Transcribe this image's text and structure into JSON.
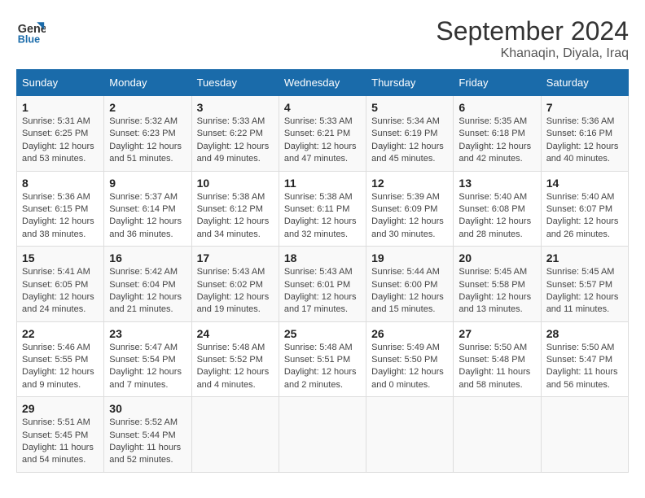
{
  "header": {
    "logo_line1": "General",
    "logo_line2": "Blue",
    "month": "September 2024",
    "location": "Khanaqin, Diyala, Iraq"
  },
  "days_of_week": [
    "Sunday",
    "Monday",
    "Tuesday",
    "Wednesday",
    "Thursday",
    "Friday",
    "Saturday"
  ],
  "weeks": [
    [
      {
        "day": "1",
        "sunrise": "Sunrise: 5:31 AM",
        "sunset": "Sunset: 6:25 PM",
        "daylight": "Daylight: 12 hours and 53 minutes."
      },
      {
        "day": "2",
        "sunrise": "Sunrise: 5:32 AM",
        "sunset": "Sunset: 6:23 PM",
        "daylight": "Daylight: 12 hours and 51 minutes."
      },
      {
        "day": "3",
        "sunrise": "Sunrise: 5:33 AM",
        "sunset": "Sunset: 6:22 PM",
        "daylight": "Daylight: 12 hours and 49 minutes."
      },
      {
        "day": "4",
        "sunrise": "Sunrise: 5:33 AM",
        "sunset": "Sunset: 6:21 PM",
        "daylight": "Daylight: 12 hours and 47 minutes."
      },
      {
        "day": "5",
        "sunrise": "Sunrise: 5:34 AM",
        "sunset": "Sunset: 6:19 PM",
        "daylight": "Daylight: 12 hours and 45 minutes."
      },
      {
        "day": "6",
        "sunrise": "Sunrise: 5:35 AM",
        "sunset": "Sunset: 6:18 PM",
        "daylight": "Daylight: 12 hours and 42 minutes."
      },
      {
        "day": "7",
        "sunrise": "Sunrise: 5:36 AM",
        "sunset": "Sunset: 6:16 PM",
        "daylight": "Daylight: 12 hours and 40 minutes."
      }
    ],
    [
      {
        "day": "8",
        "sunrise": "Sunrise: 5:36 AM",
        "sunset": "Sunset: 6:15 PM",
        "daylight": "Daylight: 12 hours and 38 minutes."
      },
      {
        "day": "9",
        "sunrise": "Sunrise: 5:37 AM",
        "sunset": "Sunset: 6:14 PM",
        "daylight": "Daylight: 12 hours and 36 minutes."
      },
      {
        "day": "10",
        "sunrise": "Sunrise: 5:38 AM",
        "sunset": "Sunset: 6:12 PM",
        "daylight": "Daylight: 12 hours and 34 minutes."
      },
      {
        "day": "11",
        "sunrise": "Sunrise: 5:38 AM",
        "sunset": "Sunset: 6:11 PM",
        "daylight": "Daylight: 12 hours and 32 minutes."
      },
      {
        "day": "12",
        "sunrise": "Sunrise: 5:39 AM",
        "sunset": "Sunset: 6:09 PM",
        "daylight": "Daylight: 12 hours and 30 minutes."
      },
      {
        "day": "13",
        "sunrise": "Sunrise: 5:40 AM",
        "sunset": "Sunset: 6:08 PM",
        "daylight": "Daylight: 12 hours and 28 minutes."
      },
      {
        "day": "14",
        "sunrise": "Sunrise: 5:40 AM",
        "sunset": "Sunset: 6:07 PM",
        "daylight": "Daylight: 12 hours and 26 minutes."
      }
    ],
    [
      {
        "day": "15",
        "sunrise": "Sunrise: 5:41 AM",
        "sunset": "Sunset: 6:05 PM",
        "daylight": "Daylight: 12 hours and 24 minutes."
      },
      {
        "day": "16",
        "sunrise": "Sunrise: 5:42 AM",
        "sunset": "Sunset: 6:04 PM",
        "daylight": "Daylight: 12 hours and 21 minutes."
      },
      {
        "day": "17",
        "sunrise": "Sunrise: 5:43 AM",
        "sunset": "Sunset: 6:02 PM",
        "daylight": "Daylight: 12 hours and 19 minutes."
      },
      {
        "day": "18",
        "sunrise": "Sunrise: 5:43 AM",
        "sunset": "Sunset: 6:01 PM",
        "daylight": "Daylight: 12 hours and 17 minutes."
      },
      {
        "day": "19",
        "sunrise": "Sunrise: 5:44 AM",
        "sunset": "Sunset: 6:00 PM",
        "daylight": "Daylight: 12 hours and 15 minutes."
      },
      {
        "day": "20",
        "sunrise": "Sunrise: 5:45 AM",
        "sunset": "Sunset: 5:58 PM",
        "daylight": "Daylight: 12 hours and 13 minutes."
      },
      {
        "day": "21",
        "sunrise": "Sunrise: 5:45 AM",
        "sunset": "Sunset: 5:57 PM",
        "daylight": "Daylight: 12 hours and 11 minutes."
      }
    ],
    [
      {
        "day": "22",
        "sunrise": "Sunrise: 5:46 AM",
        "sunset": "Sunset: 5:55 PM",
        "daylight": "Daylight: 12 hours and 9 minutes."
      },
      {
        "day": "23",
        "sunrise": "Sunrise: 5:47 AM",
        "sunset": "Sunset: 5:54 PM",
        "daylight": "Daylight: 12 hours and 7 minutes."
      },
      {
        "day": "24",
        "sunrise": "Sunrise: 5:48 AM",
        "sunset": "Sunset: 5:52 PM",
        "daylight": "Daylight: 12 hours and 4 minutes."
      },
      {
        "day": "25",
        "sunrise": "Sunrise: 5:48 AM",
        "sunset": "Sunset: 5:51 PM",
        "daylight": "Daylight: 12 hours and 2 minutes."
      },
      {
        "day": "26",
        "sunrise": "Sunrise: 5:49 AM",
        "sunset": "Sunset: 5:50 PM",
        "daylight": "Daylight: 12 hours and 0 minutes."
      },
      {
        "day": "27",
        "sunrise": "Sunrise: 5:50 AM",
        "sunset": "Sunset: 5:48 PM",
        "daylight": "Daylight: 11 hours and 58 minutes."
      },
      {
        "day": "28",
        "sunrise": "Sunrise: 5:50 AM",
        "sunset": "Sunset: 5:47 PM",
        "daylight": "Daylight: 11 hours and 56 minutes."
      }
    ],
    [
      {
        "day": "29",
        "sunrise": "Sunrise: 5:51 AM",
        "sunset": "Sunset: 5:45 PM",
        "daylight": "Daylight: 11 hours and 54 minutes."
      },
      {
        "day": "30",
        "sunrise": "Sunrise: 5:52 AM",
        "sunset": "Sunset: 5:44 PM",
        "daylight": "Daylight: 11 hours and 52 minutes."
      },
      {
        "day": "",
        "sunrise": "",
        "sunset": "",
        "daylight": ""
      },
      {
        "day": "",
        "sunrise": "",
        "sunset": "",
        "daylight": ""
      },
      {
        "day": "",
        "sunrise": "",
        "sunset": "",
        "daylight": ""
      },
      {
        "day": "",
        "sunrise": "",
        "sunset": "",
        "daylight": ""
      },
      {
        "day": "",
        "sunrise": "",
        "sunset": "",
        "daylight": ""
      }
    ]
  ]
}
